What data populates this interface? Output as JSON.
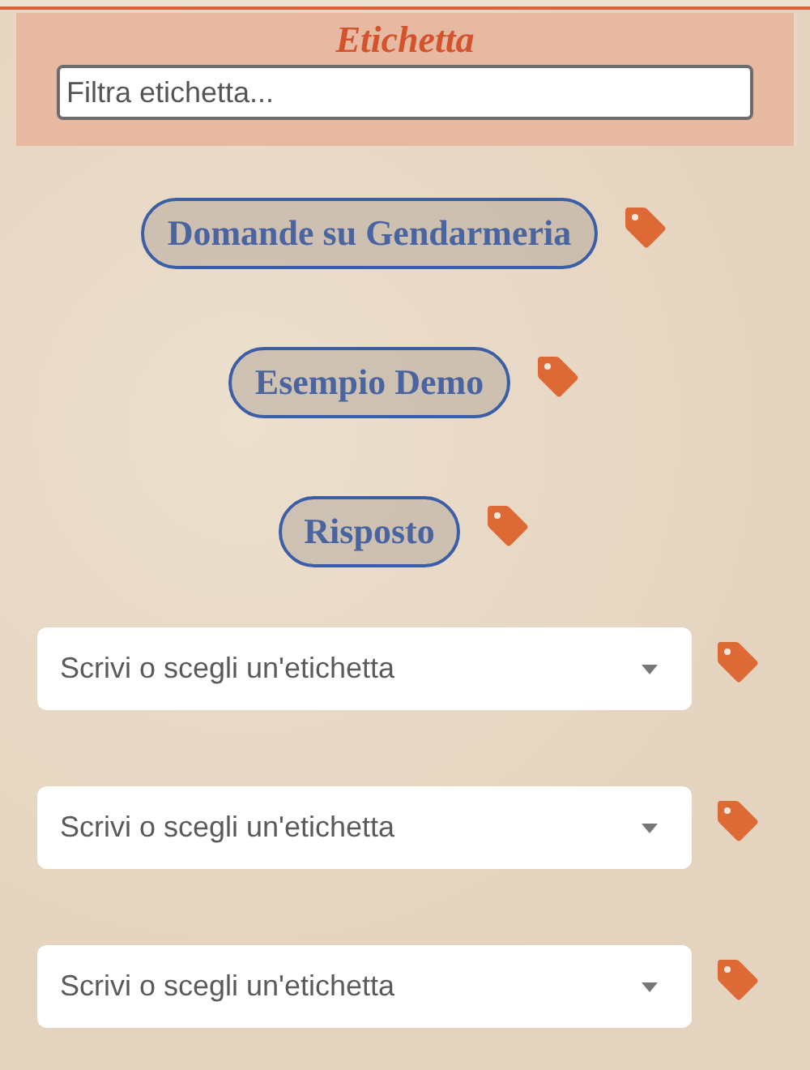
{
  "header": {
    "title": "Etichetta",
    "filter": {
      "placeholder": "Filtra etichetta..."
    }
  },
  "tags": [
    {
      "label": "Domande su Gendarmeria"
    },
    {
      "label": "Esempio Demo"
    },
    {
      "label": "Risposto"
    }
  ],
  "tag_pickers": [
    {
      "placeholder": "Scrivi o scegli un'etichetta"
    },
    {
      "placeholder": "Scrivi o scegli un'etichetta"
    },
    {
      "placeholder": "Scrivi o scegli un'etichetta"
    }
  ]
}
